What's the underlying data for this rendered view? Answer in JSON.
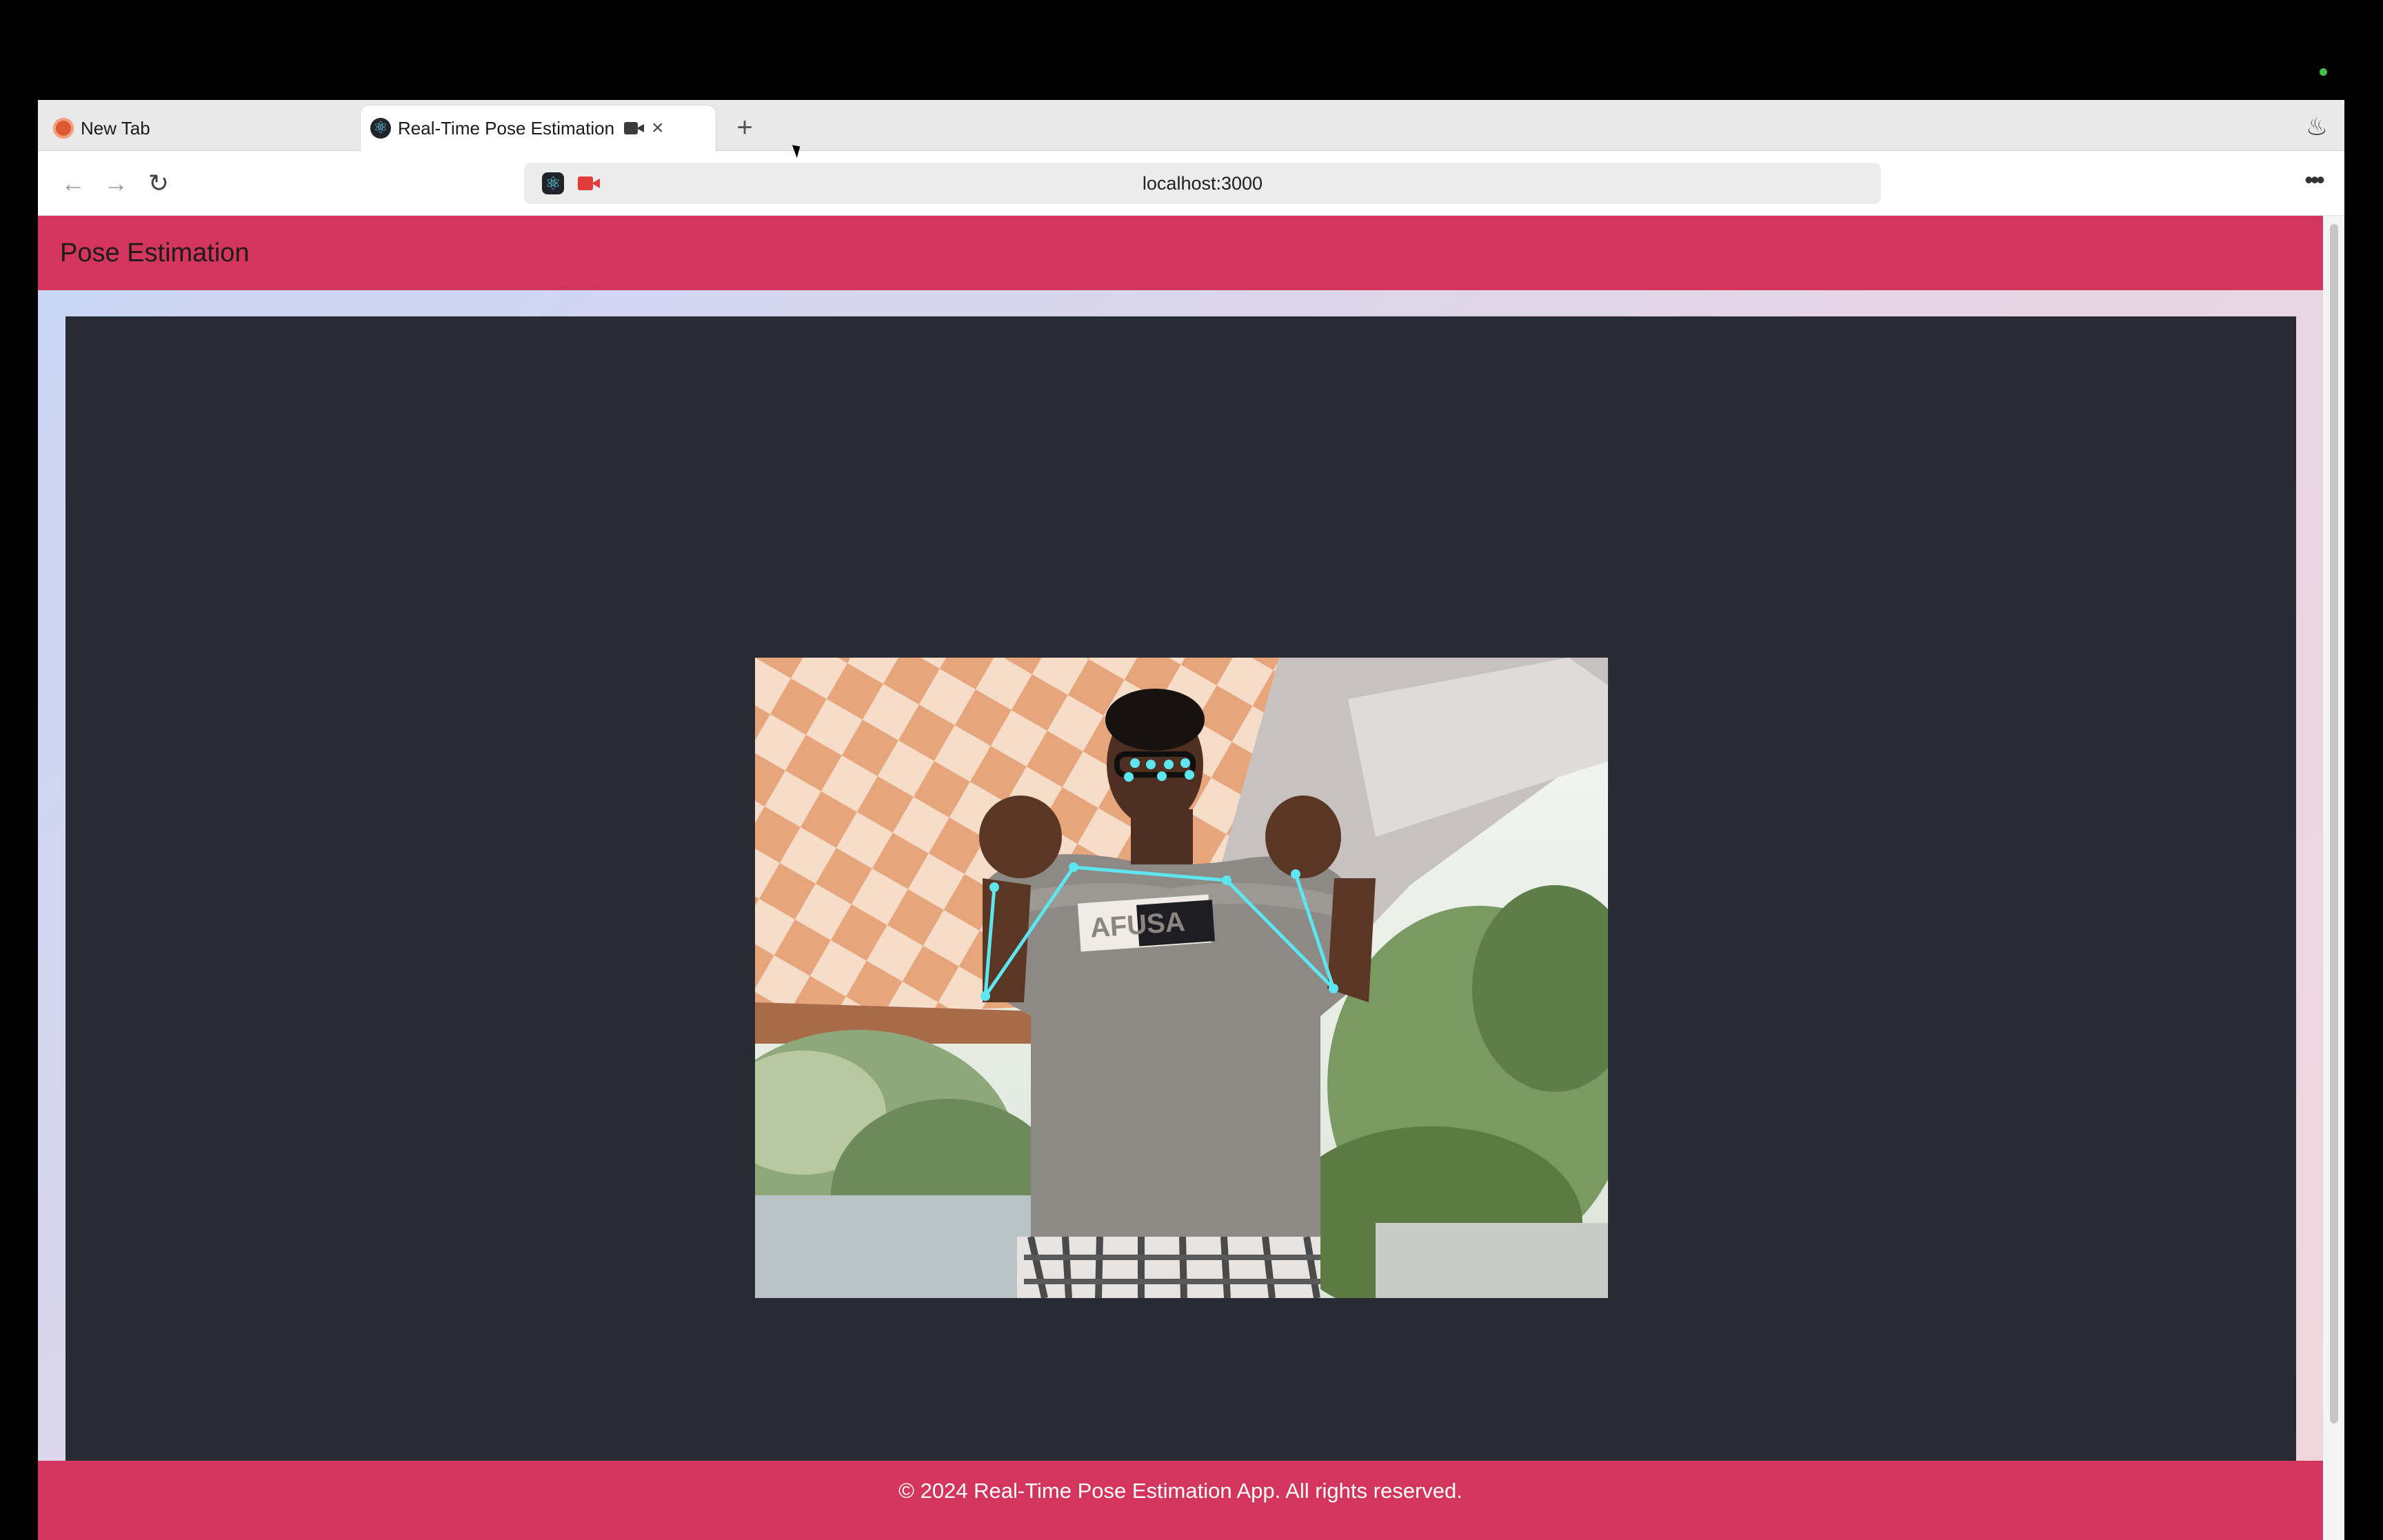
{
  "tabs": [
    {
      "label": "New Tab"
    },
    {
      "label": "Real-Time Pose Estimation"
    }
  ],
  "toolbar": {
    "url": "localhost:3000"
  },
  "page": {
    "header_title": "Pose Estimation",
    "footer_text": "© 2024 Real-Time Pose Estimation App. All rights reserved."
  },
  "icons": {
    "new_tab_favicon": "duckduckgo-icon",
    "active_tab_favicon": "react-icon",
    "camera_indicator": "camera-icon",
    "close": "close-icon",
    "new_tab": "plus-icon",
    "fire": "fire-icon",
    "back": "back-arrow-icon",
    "forward": "forward-arrow-icon",
    "reload": "reload-icon",
    "menu": "more-horizontal-icon"
  },
  "colors": {
    "accent": "#d4355c",
    "stage_bg": "#282b34",
    "skeleton": "#5ee6f0"
  }
}
